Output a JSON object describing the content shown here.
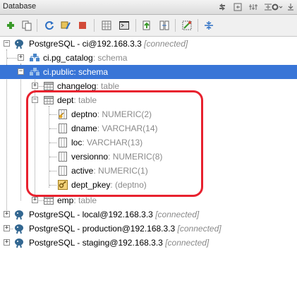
{
  "panel": {
    "title": "Database"
  },
  "colors": {
    "selection": "#3875d7",
    "highlight": "#e8212e",
    "muted": "#8a8a8a"
  },
  "toolbar": {
    "icons": [
      "add-icon",
      "copy-icon",
      "refresh-icon",
      "properties-icon",
      "stop-icon",
      "table-icon",
      "console-icon",
      "export-icon",
      "compare-icon",
      "diagram-icon",
      "collapse-icon"
    ]
  },
  "tree": {
    "ds_ci": {
      "name": "PostgreSQL - ci@192.168.3.3",
      "status": "[connected]"
    },
    "pg_catalog": {
      "name": "ci.pg_catalog",
      "type": ": schema"
    },
    "public": {
      "name": "ci.public",
      "type": ": schema"
    },
    "changelog": {
      "name": "changelog",
      "type": ": table"
    },
    "dept": {
      "name": "dept",
      "type": ": table"
    },
    "columns": [
      {
        "name": "deptno",
        "type": ": NUMERIC(2)"
      },
      {
        "name": "dname",
        "type": ": VARCHAR(14)"
      },
      {
        "name": "loc",
        "type": ": VARCHAR(13)"
      },
      {
        "name": "versionno",
        "type": ": NUMERIC(8)"
      },
      {
        "name": "active",
        "type": ": NUMERIC(1)"
      }
    ],
    "pkey": {
      "name": "dept_pkey",
      "detail": ": (deptno)"
    },
    "emp": {
      "name": "emp",
      "type": ": table"
    },
    "ds_local": {
      "name": "PostgreSQL - local@192.168.3.3",
      "status": "[connected]"
    },
    "ds_production": {
      "name": "PostgreSQL - production@192.168.3.3",
      "status": "[connected]"
    },
    "ds_staging": {
      "name": "PostgreSQL - staging@192.168.3.3",
      "status": "[connected]"
    }
  }
}
